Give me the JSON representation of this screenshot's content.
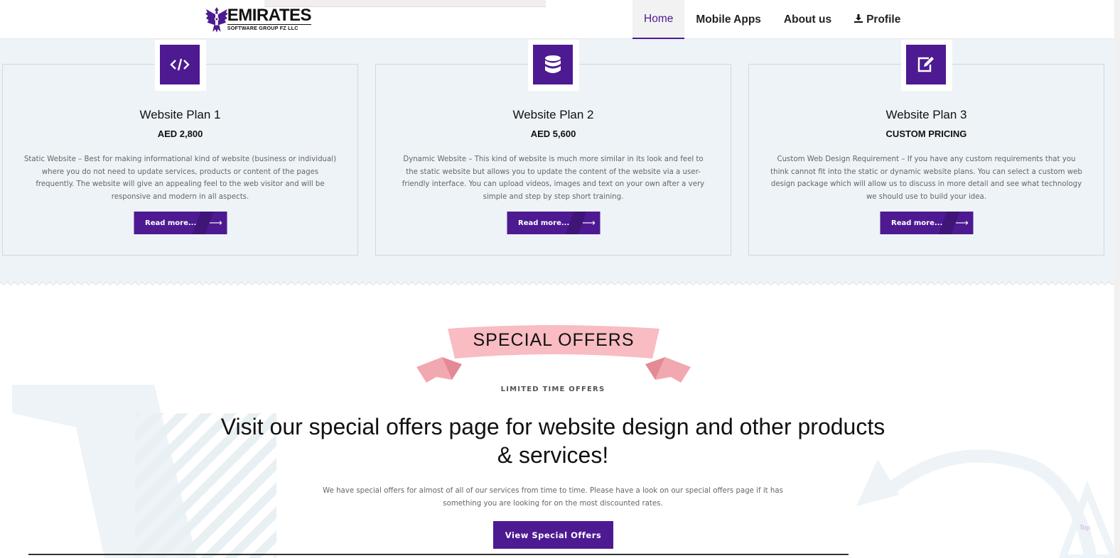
{
  "header": {
    "logo": {
      "brand": "EMIRATES",
      "subtitle": "SOFTWARE GROUP FZ LLC"
    },
    "nav": [
      {
        "label": "Home",
        "active": true
      },
      {
        "label": "Mobile Apps"
      },
      {
        "label": "About us"
      },
      {
        "label": "Profile",
        "icon": "download-icon"
      }
    ]
  },
  "plans": [
    {
      "icon": "code-icon",
      "title": "Website Plan 1",
      "price": "AED 2,800",
      "description": "Static Website – Best for making informational kind of website (business or individual) where you do not need to update services, products or content of the pages frequently. The website will give an appealing feel to the web visitor and will be responsive and modern in all aspects.",
      "button": "Read more..."
    },
    {
      "icon": "database-icon",
      "title": "Website Plan 2",
      "price": "AED 5,600",
      "description": "Dynamic Website – This kind of website is much more similar in its look and feel to the static website but allows you to update the content of the website via a user-friendly interface. You can upload videos, images and text on your own after a very simple and step by step short training.",
      "button": "Read more..."
    },
    {
      "icon": "edit-icon",
      "title": "Website Plan 3",
      "price": "CUSTOM PRICING",
      "description": "Custom Web Design Requirement – If you have any custom requirements that you think cannot fit into the static or dynamic website plans. You can select a custom web design package which will allow us to discuss in more detail and see what technology we should use to build your idea.",
      "button": "Read more..."
    }
  ],
  "offers": {
    "ribbon": "SPECIAL OFFERS",
    "kicker": "LIMITED TIME OFFERS",
    "headline": "Visit our special offers page for website design and other products & services!",
    "body": "We have special offers for almost of all of our services from time to time. Please have a look on our special offers page if it has something you are looking for on the most discounted rates.",
    "button": "View Special Offers",
    "top_link": "Top"
  },
  "colors": {
    "accent": "#4d1a91",
    "section_bg": "#edf3f7",
    "ribbon": "#f8bcc2"
  }
}
